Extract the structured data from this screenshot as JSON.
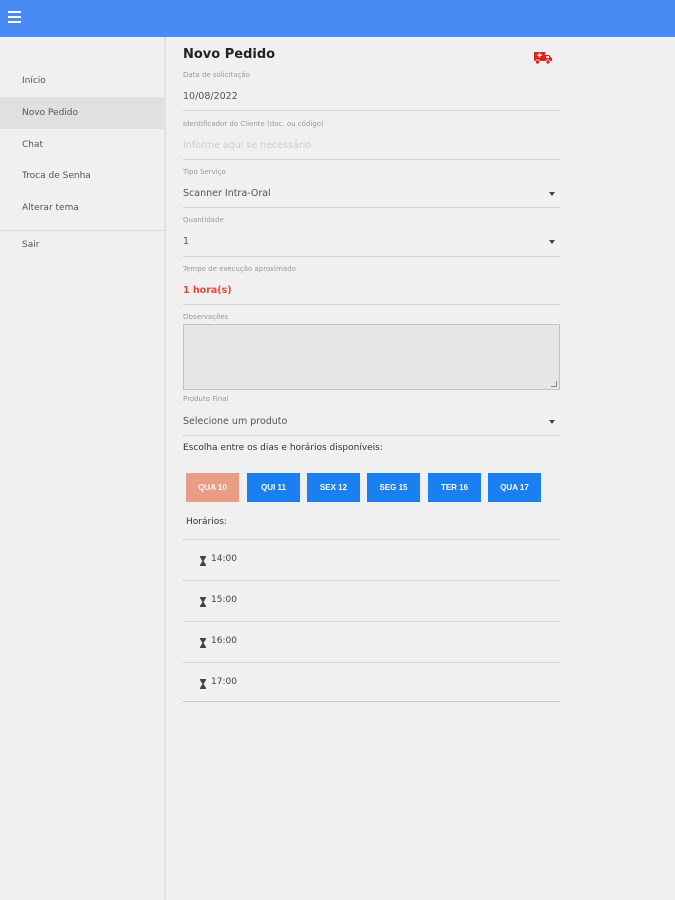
{
  "sidebar": {
    "items": [
      {
        "label": "Início"
      },
      {
        "label": "Novo Pedido"
      },
      {
        "label": "Chat"
      },
      {
        "label": "Troca de Senha"
      },
      {
        "label": "Alterar tema"
      },
      {
        "label": "Sair"
      }
    ],
    "active_index": 1
  },
  "page": {
    "title": "Novo Pedido"
  },
  "form": {
    "date": {
      "label": "Data de solicitação",
      "value": "10/08/2022"
    },
    "client_id": {
      "label": "Identificador do Cliente (doc. ou código)",
      "placeholder": "Informe aqui se necessário"
    },
    "service_type": {
      "label": "Tipo Serviço",
      "value": "Scanner Intra-Oral"
    },
    "quantity": {
      "label": "Quantidade",
      "value": "1"
    },
    "execution_time": {
      "label": "Tempo de execução aproximado",
      "value": "1 hora(s)"
    },
    "notes": {
      "label": "Observações",
      "value": ""
    },
    "final_product": {
      "label": "Produto Final",
      "value": "Selecione um produto"
    }
  },
  "schedule": {
    "title": "Escolha entre os dias e horários disponíveis:",
    "days": [
      "QUA 10",
      "QUI 11",
      "SEX 12",
      "SEG 15",
      "TER 16",
      "QUA 17"
    ],
    "selected_day_index": 0,
    "hours_label": "Horários:",
    "slots": [
      "14:00",
      "15:00",
      "16:00",
      "17:00"
    ]
  },
  "colors": {
    "topbar": "#4a8af4",
    "day_button": "#1a7ff0",
    "day_button_selected": "#e89d84",
    "accent": "#e8453c",
    "truck_icon": "#e0201a"
  },
  "icons": {
    "menu": "hamburger-icon",
    "truck": "delivery-truck-icon",
    "dropdown": "caret-down-icon",
    "slot": "hourglass-icon"
  }
}
